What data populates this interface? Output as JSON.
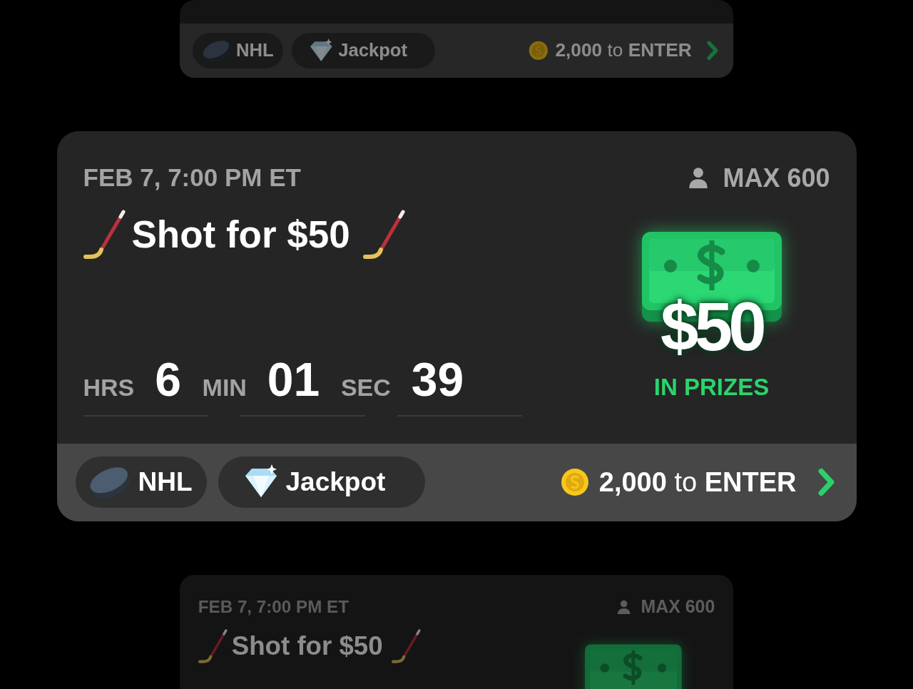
{
  "cards": [
    {
      "selected": false,
      "tags": [
        {
          "kind": "league",
          "label": "NHL"
        },
        {
          "kind": "jackpot",
          "label": "Jackpot"
        }
      ],
      "entry": "**2,000** to **ENTER**"
    },
    {
      "selected": true,
      "date": "FEB 7, 7:00 PM ET",
      "max": "MAX 600",
      "title": "Shot for $50",
      "countdown": [
        {
          "unit": "HRS",
          "value": "6"
        },
        {
          "unit": "MIN",
          "value": "01"
        },
        {
          "unit": "SEC",
          "value": "39"
        }
      ],
      "prize": {
        "amount": "$50",
        "caption": "IN PRIZES"
      },
      "tags": [
        {
          "kind": "league",
          "label": "NHL"
        },
        {
          "kind": "jackpot",
          "label": "Jackpot"
        }
      ],
      "entry": "**2,000** to **ENTER**"
    },
    {
      "selected": false,
      "date": "FEB 7, 7:00 PM ET",
      "max": "MAX 600",
      "title": "Shot for $50"
    }
  ]
}
